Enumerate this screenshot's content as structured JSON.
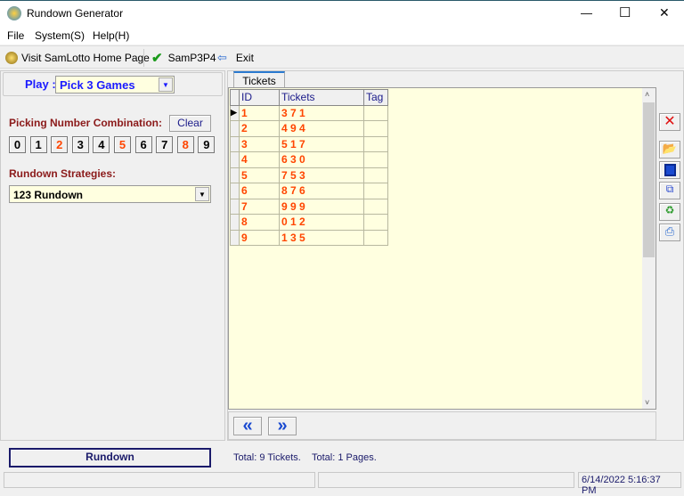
{
  "window": {
    "title": "Rundown Generator",
    "minimize": "—",
    "maximize": "☐",
    "close": "✕"
  },
  "menu": [
    "File",
    "System(S)",
    "Help(H)"
  ],
  "toolbar": {
    "home": "Visit SamLotto Home Page",
    "samp": "SamP3P4",
    "exit": "Exit"
  },
  "play": {
    "label": "Play :",
    "value": "Pick 3 Games"
  },
  "picking": {
    "label": "Picking Number Combination:",
    "clear": "Clear",
    "numbers": [
      {
        "n": "0",
        "sel": false
      },
      {
        "n": "1",
        "sel": false
      },
      {
        "n": "2",
        "sel": true
      },
      {
        "n": "3",
        "sel": false
      },
      {
        "n": "4",
        "sel": false
      },
      {
        "n": "5",
        "sel": true
      },
      {
        "n": "6",
        "sel": false
      },
      {
        "n": "7",
        "sel": false
      },
      {
        "n": "8",
        "sel": true
      },
      {
        "n": "9",
        "sel": false
      }
    ]
  },
  "strategies": {
    "label": "Rundown Strategies:",
    "value": "123 Rundown"
  },
  "tab": "Tickets",
  "grid": {
    "columns": [
      "ID",
      "Tickets",
      "Tag"
    ],
    "rows": [
      [
        "1",
        "3 7 1",
        ""
      ],
      [
        "2",
        "4 9 4",
        ""
      ],
      [
        "3",
        "5 1 7",
        ""
      ],
      [
        "4",
        "6 3 0",
        ""
      ],
      [
        "5",
        "7 5 3",
        ""
      ],
      [
        "6",
        "8 7 6",
        ""
      ],
      [
        "7",
        "9 9 9",
        ""
      ],
      [
        "8",
        "0 1 2",
        ""
      ],
      [
        "9",
        "1 3 5",
        ""
      ]
    ]
  },
  "nav": {
    "prev": "«",
    "next": "»"
  },
  "rundown_button": "Rundown",
  "totals": {
    "tickets": "Total: 9 Tickets.",
    "pages": "Total: 1 Pages."
  },
  "status": {
    "datetime": "6/14/2022 5:16:37 PM"
  },
  "colors": {
    "selected": "#ff4500",
    "accent": "#1a1aff"
  }
}
